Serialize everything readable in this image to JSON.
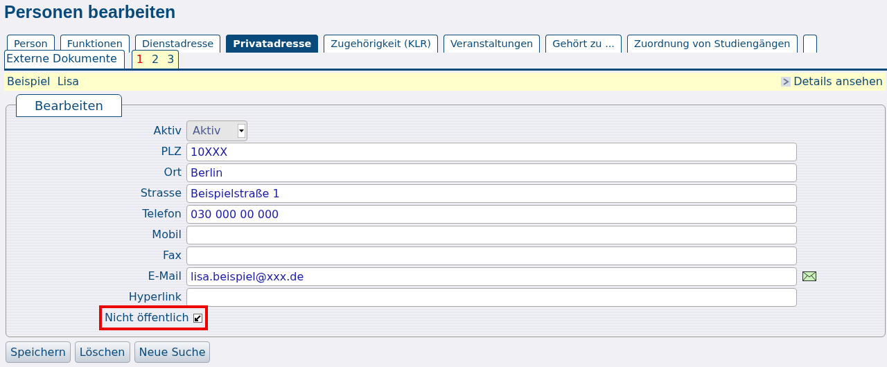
{
  "title": "Personen bearbeiten",
  "tabs": [
    {
      "label": "Person",
      "selected": false
    },
    {
      "label": "Funktionen",
      "selected": false
    },
    {
      "label": "Dienstadresse",
      "selected": false
    },
    {
      "label": "Privatadresse",
      "selected": true
    },
    {
      "label": "Zugehörigkeit (KLR)",
      "selected": false
    },
    {
      "label": "Veranstaltungen",
      "selected": false
    },
    {
      "label": "Gehört zu ...",
      "selected": false
    },
    {
      "label": "Zuordnung von Studiengängen",
      "selected": false
    }
  ],
  "second_row_tab": {
    "label": "Externe Dokumente"
  },
  "pager": [
    {
      "label": "1",
      "selected": true
    },
    {
      "label": "2",
      "selected": false
    },
    {
      "label": "3",
      "selected": false
    }
  ],
  "person": {
    "last_name": "Beispiel",
    "first_name": "Lisa"
  },
  "details_link": "Details ansehen",
  "fieldset": {
    "legend": "Bearbeiten"
  },
  "fields": [
    {
      "kind": "select",
      "label": "Aktiv",
      "value": "Aktiv",
      "disabled": true
    },
    {
      "kind": "text",
      "label": "PLZ",
      "value": "10XXX"
    },
    {
      "kind": "text",
      "label": "Ort",
      "value": "Berlin"
    },
    {
      "kind": "text",
      "label": "Strasse",
      "value": "Beispielstraße 1"
    },
    {
      "kind": "text",
      "label": "Telefon",
      "value": "030 000 00 000"
    },
    {
      "kind": "text",
      "label": "Mobil"
    },
    {
      "kind": "text",
      "label": "Fax"
    },
    {
      "kind": "email",
      "label": "E-Mail",
      "value": "lisa.beispiel@xxx.de"
    },
    {
      "kind": "text",
      "label": "Hyperlink"
    },
    {
      "kind": "checkbox",
      "label": "Nicht öffentlich",
      "checked": true,
      "highlighted": true
    }
  ],
  "buttons": [
    "Speichern",
    "Löschen",
    "Neue Suche"
  ]
}
